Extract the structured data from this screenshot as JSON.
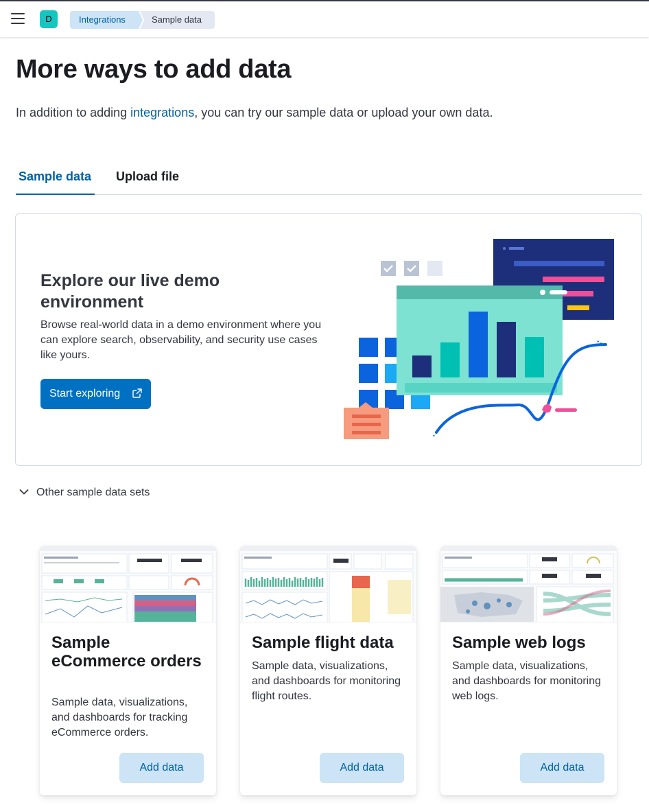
{
  "header": {
    "avatar_letter": "D",
    "breadcrumbs": [
      {
        "label": "Integrations"
      },
      {
        "label": "Sample data"
      }
    ]
  },
  "page": {
    "title": "More ways to add data",
    "intro_before": "In addition to adding ",
    "intro_link": "integrations",
    "intro_after": ", you can try our sample data or upload your own data."
  },
  "tabs": [
    {
      "label": "Sample data",
      "active": true
    },
    {
      "label": "Upload file",
      "active": false
    }
  ],
  "demo": {
    "title": "Explore our live demo environment",
    "description": "Browse real-world data in a demo environment where you can explore search, observability, and security use cases like yours.",
    "button_label": "Start exploring"
  },
  "accordion": {
    "label": "Other sample data sets"
  },
  "cards": [
    {
      "title": "Sample eCommerce orders",
      "description": "Sample data, visualizations, and dashboards for tracking eCommerce orders.",
      "button_label": "Add data"
    },
    {
      "title": "Sample flight data",
      "description": "Sample data, visualizations, and dashboards for monitoring flight routes.",
      "button_label": "Add data"
    },
    {
      "title": "Sample web logs",
      "description": "Sample data, visualizations, and dashboards for monitoring web logs.",
      "button_label": "Add data"
    }
  ],
  "colors": {
    "primary": "#0071c2",
    "link": "#0061a6",
    "light_button": "#cce4f5",
    "avatar": "#16c5c0"
  }
}
